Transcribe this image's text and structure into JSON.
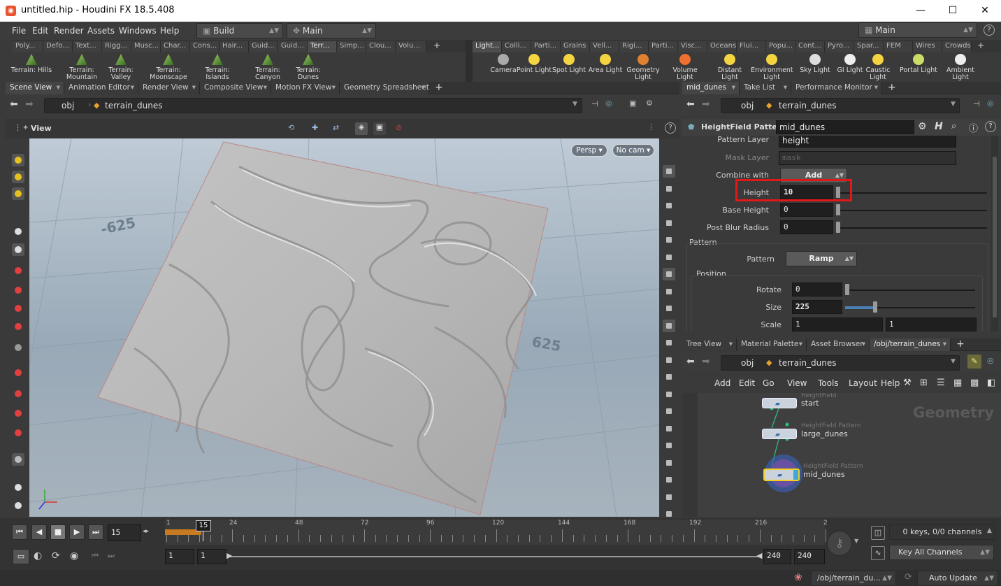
{
  "window": {
    "title": "untitled.hip - Houdini FX 18.5.408"
  },
  "menubar": {
    "items": [
      "File",
      "Edit",
      "Render",
      "Assets",
      "Windows",
      "Help"
    ],
    "desktop": "Build",
    "network_desk": "Main",
    "main_right": "Main"
  },
  "shelf_left": {
    "tabs": [
      "Poly...",
      "Defo...",
      "Text...",
      "Rigg...",
      "Musc...",
      "Char...",
      "Cons...",
      "Hair...",
      "Guid...",
      "Guid...",
      "Terr...",
      "Simp...",
      "Clou...",
      "Volu..."
    ],
    "tools": [
      "Terrain: Hills",
      "Terrain: Mountain",
      "Terrain: Valley",
      "Terrain: Moonscape",
      "Terrain: Islands",
      "Terrain: Canyon",
      "Terrain: Dunes"
    ]
  },
  "shelf_right": {
    "tabs": [
      "Light...",
      "Colli...",
      "Parti...",
      "Grains",
      "Vell...",
      "Rigi...",
      "Parti...",
      "Visc...",
      "Oceans",
      "Flui...",
      "Popu...",
      "Cont...",
      "Pyro...",
      "Spar...",
      "FEM",
      "Wires",
      "Crowds"
    ],
    "tools": [
      "Camera",
      "Point Light",
      "Spot Light",
      "Area Light",
      "Geometry Light",
      "Volume Light",
      "Distant Light",
      "Environment Light",
      "Sky Light",
      "GI Light",
      "Caustic Light",
      "Portal Light",
      "Ambient Light"
    ]
  },
  "left_pane": {
    "tabs": [
      "Scene View",
      "Animation Editor",
      "Render View",
      "Composite View",
      "Motion FX View",
      "Geometry Spreadsheet"
    ],
    "path": [
      "obj",
      "terrain_dunes"
    ],
    "view_label": "View",
    "persp": "Persp",
    "cam": "No cam",
    "grid_labels": [
      "-625",
      "625",
      "-625",
      "625"
    ]
  },
  "param_pane": {
    "tabs": [
      "mid_dunes",
      "Take List",
      "Performance Monitor"
    ],
    "path": [
      "obj",
      "terrain_dunes"
    ],
    "node_type": "HeightField Pattern",
    "node_name": "mid_dunes",
    "pattern_layer_label": "Pattern Layer",
    "pattern_layer": "height",
    "mask_layer_label": "Mask Layer",
    "mask_layer": "mask",
    "combine_label": "Combine with",
    "combine": "Add",
    "height_label": "Height",
    "height": "10",
    "base_height_label": "Base Height",
    "base_height": "0",
    "post_blur_label": "Post Blur Radius",
    "post_blur": "0",
    "pattern_section": "Pattern",
    "pattern_label": "Pattern",
    "pattern": "Ramp",
    "position_section": "Position",
    "rotate_label": "Rotate",
    "rotate": "0",
    "size_label": "Size",
    "size": "225",
    "scale_label": "Scale",
    "scale_x": "1",
    "scale_y": "1"
  },
  "network_pane": {
    "tabs": [
      "Tree View",
      "Material Palette",
      "Asset Browser",
      "/obj/terrain_dunes"
    ],
    "path": [
      "obj",
      "terrain_dunes"
    ],
    "menu": [
      "Add",
      "Edit",
      "Go",
      "View",
      "Tools",
      "Layout",
      "Help"
    ],
    "context_label": "Geometry",
    "nodes": [
      {
        "type": "HeightField",
        "name": "start"
      },
      {
        "type": "HeightField Pattern",
        "name": "large_dunes"
      },
      {
        "type": "HeightField Pattern",
        "name": "mid_dunes"
      }
    ]
  },
  "timeline": {
    "current_frame": "15",
    "ticks": [
      "1",
      "24",
      "48",
      "72",
      "96",
      "120",
      "144",
      "168",
      "192",
      "216",
      "2"
    ],
    "start": "1",
    "range_start": "1",
    "range_end": "240",
    "end": "240",
    "keys_info": "0 keys, 0/0 channels",
    "key_all": "Key All Channels"
  },
  "status": {
    "path": "/obj/terrain_du...",
    "update": "Auto Update"
  }
}
